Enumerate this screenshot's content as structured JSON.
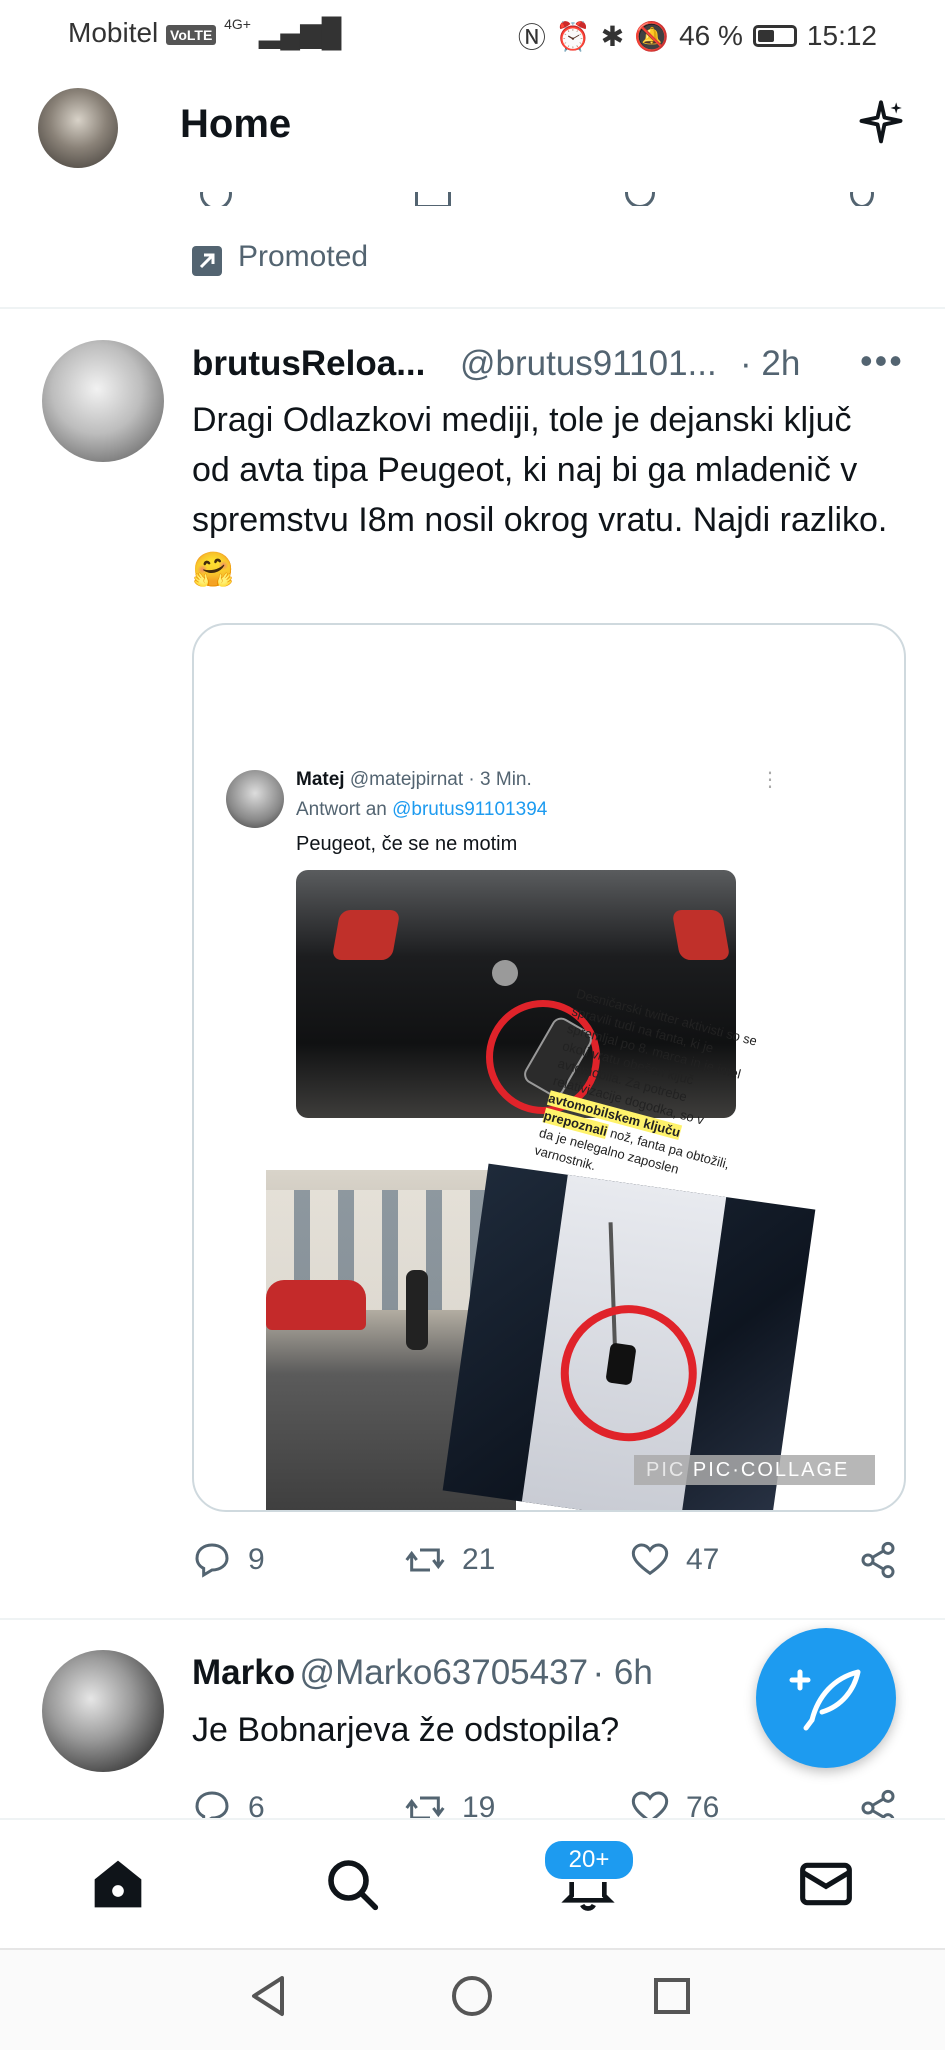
{
  "status_bar": {
    "carrier": "Mobitel",
    "volte": "VoLTE",
    "network": "4G+",
    "battery": "46 %",
    "time": "15:12"
  },
  "header": {
    "title": "Home"
  },
  "promoted": {
    "label": "Promoted"
  },
  "tweets": [
    {
      "name": "brutusReloa...",
      "handle": "@brutus91101...",
      "time": "· 2h",
      "text": "Dragi Odlazkovi mediji, tole je dejanski ključ od avta tipa Peugeot, ki naj bi ga mladenič v spremstvu I8m nosil okrog vratu. Najdi razliko. 🤗",
      "actions": {
        "replies": "9",
        "retweets": "21",
        "likes": "47"
      },
      "media": {
        "quote_name": "Matej",
        "quote_handle": "@matejpirnat · 3 Min.",
        "quote_reply_prefix": "Antwort an",
        "quote_reply_handle": "@brutus91101394",
        "quote_text": "Peugeot, če se ne motim",
        "article_text": "Desničarski twitter aktivisti so se spravili tudi na fanta, ki je spremljal po 8. marca in je imel okoli vratu obešen ključ avtomobila. Za potrebe relativizacije dogodka, so v",
        "article_highlight": "avtomobilskem ključu prepoznali",
        "article_text_end": "nož, fanta pa obtožili, da je nelegalno zaposlen varnostnik.",
        "watermark": "PIC·COLLAGE",
        "watermark_prefix": "PIC"
      }
    },
    {
      "name": "Marko",
      "handle": "@Marko63705437",
      "time": "· 6h",
      "text": "Je Bobnarjeva že odstopila?",
      "actions": {
        "replies": "6",
        "retweets": "19",
        "likes": "76"
      }
    }
  ],
  "bottom_nav": {
    "notifications_badge": "20+"
  }
}
